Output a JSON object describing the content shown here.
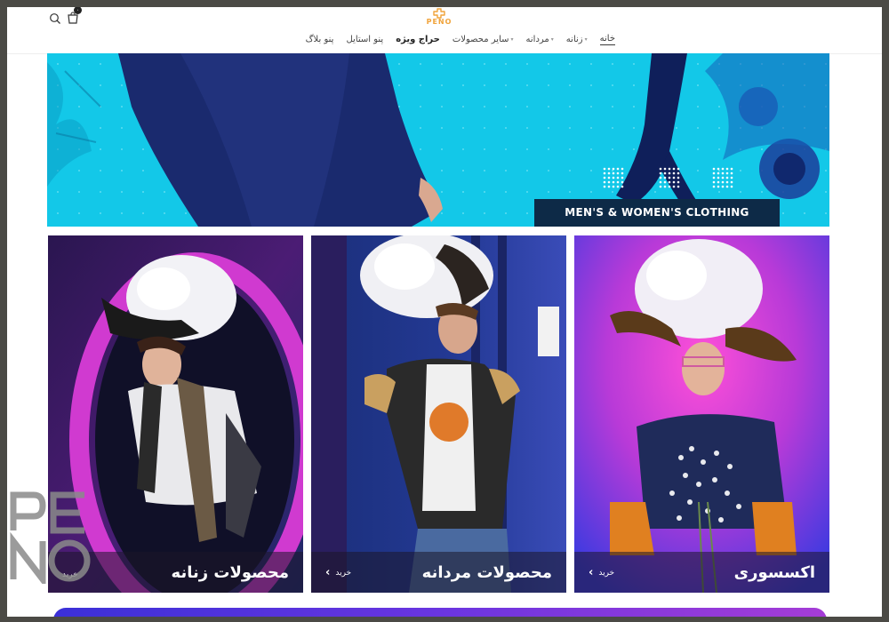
{
  "header": {
    "logo_text": "PENO",
    "cart_count": "۰",
    "nav": [
      {
        "label": "خانه",
        "active": true
      },
      {
        "label": "زنانه",
        "dropdown": true
      },
      {
        "label": "مردانه",
        "dropdown": true
      },
      {
        "label": "سایر محصولات",
        "dropdown": true
      },
      {
        "label": "حراج ویژه",
        "bold": true
      },
      {
        "label": "پنو استایل"
      },
      {
        "label": "پنو بلاگ"
      }
    ],
    "icons": {
      "search": "search-icon",
      "cart": "cart-icon",
      "chevron": "chevron-down-icon"
    }
  },
  "hero": {
    "caption": "MEN'S & WOMEN'S CLOTHING"
  },
  "categories": [
    {
      "title": "محصولات زنانه",
      "shop_label": "خرید"
    },
    {
      "title": "محصولات مردانه",
      "shop_label": "خرید"
    },
    {
      "title": "اکسسوری",
      "shop_label": "خرید"
    }
  ],
  "watermark_text": "PENO",
  "colors": {
    "brand": "#f0a33a",
    "hero_bg": "#13c8e8",
    "caption_bg": "#0d2a47",
    "strip_start": "#3b30d8",
    "strip_end": "#a53cd6"
  }
}
